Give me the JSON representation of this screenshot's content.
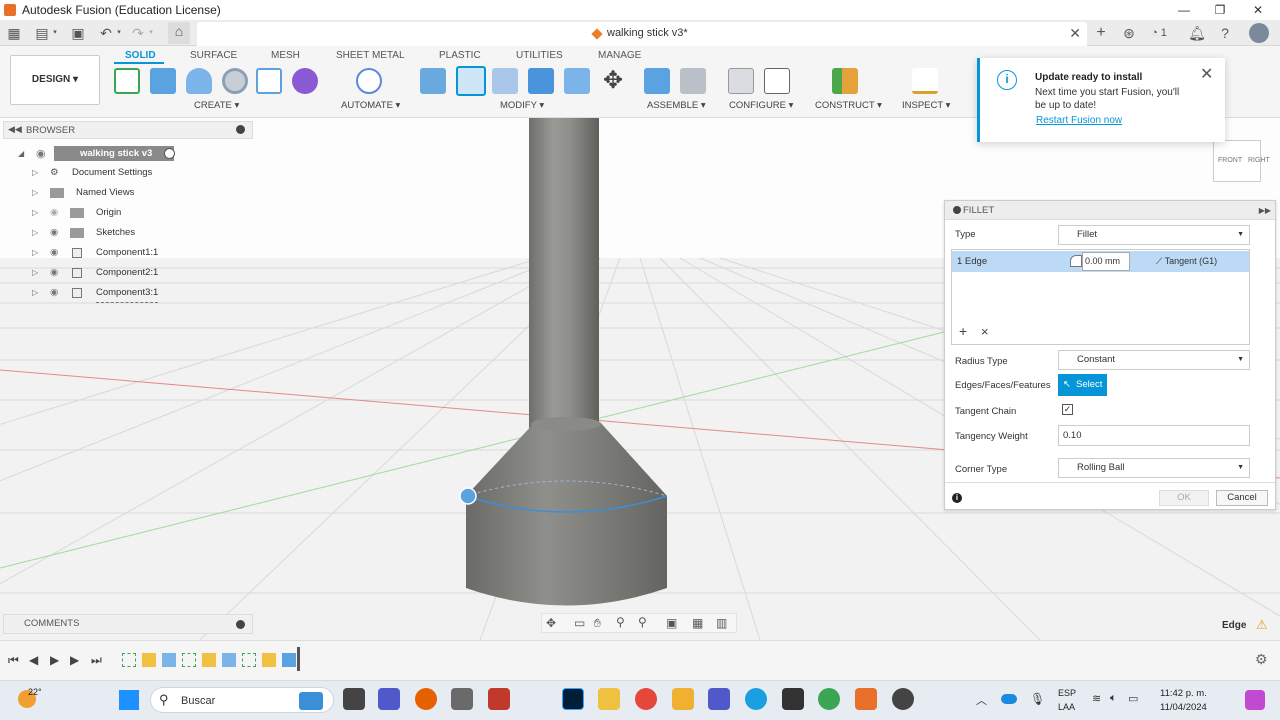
{
  "window": {
    "title": "Autodesk Fusion (Education License)"
  },
  "document": {
    "tab_title": "walking stick v3*"
  },
  "ribbon": {
    "tabs": [
      {
        "label": "SOLID",
        "active": true
      },
      {
        "label": "SURFACE",
        "active": false
      },
      {
        "label": "MESH",
        "active": false
      },
      {
        "label": "SHEET METAL",
        "active": false
      },
      {
        "label": "PLASTIC",
        "active": false
      },
      {
        "label": "UTILITIES",
        "active": false
      },
      {
        "label": "MANAGE",
        "active": false
      }
    ],
    "workspace": "DESIGN ▾",
    "groups": [
      "CREATE ▾",
      "AUTOMATE ▾",
      "MODIFY ▾",
      "ASSEMBLE ▾",
      "CONFIGURE ▾",
      "CONSTRUCT ▾",
      "INSPECT ▾"
    ]
  },
  "header_right": {
    "job_count": "1"
  },
  "notification": {
    "title": "Update ready to install",
    "body_line1": "Next time you start Fusion, you'll",
    "body_line2": "be up to date!",
    "link": "Restart Fusion now"
  },
  "browser": {
    "title": "BROWSER",
    "root": "walking stick v3",
    "items": [
      "Document Settings",
      "Named Views",
      "Origin",
      "Sketches",
      "Component1:1",
      "Component2:1",
      "Component3:1"
    ]
  },
  "comments": {
    "title": "COMMENTS"
  },
  "viewcube": {
    "front": "FRONT",
    "right": "RIGHT"
  },
  "fillet": {
    "title": "FILLET",
    "type_label": "Type",
    "type_value": "Fillet",
    "edge_row": {
      "label": "1 Edge",
      "radius": "0.00 mm",
      "continuity": "Tangent (G1)"
    },
    "radius_type_label": "Radius Type",
    "radius_type_value": "Constant",
    "edges_label": "Edges/Faces/Features",
    "select_button": "Select",
    "tangent_chain_label": "Tangent Chain",
    "tangent_chain_checked": true,
    "tangency_weight_label": "Tangency Weight",
    "tangency_weight_value": "0.10",
    "corner_type_label": "Corner Type",
    "corner_type_value": "Rolling Ball",
    "ok": "OK",
    "cancel": "Cancel",
    "add_symbol": "+",
    "remove_symbol": "×"
  },
  "status": {
    "selection": "Edge"
  },
  "taskbar": {
    "weather": "22°",
    "search_placeholder": "Buscar",
    "lang1": "ESP",
    "lang2": "LAA",
    "time": "11:42 p. m.",
    "date": "11/04/2024"
  },
  "colors": {
    "accent": "#0696d7",
    "orange": "#e8702a",
    "highlight_row": "#bcd9f5"
  }
}
